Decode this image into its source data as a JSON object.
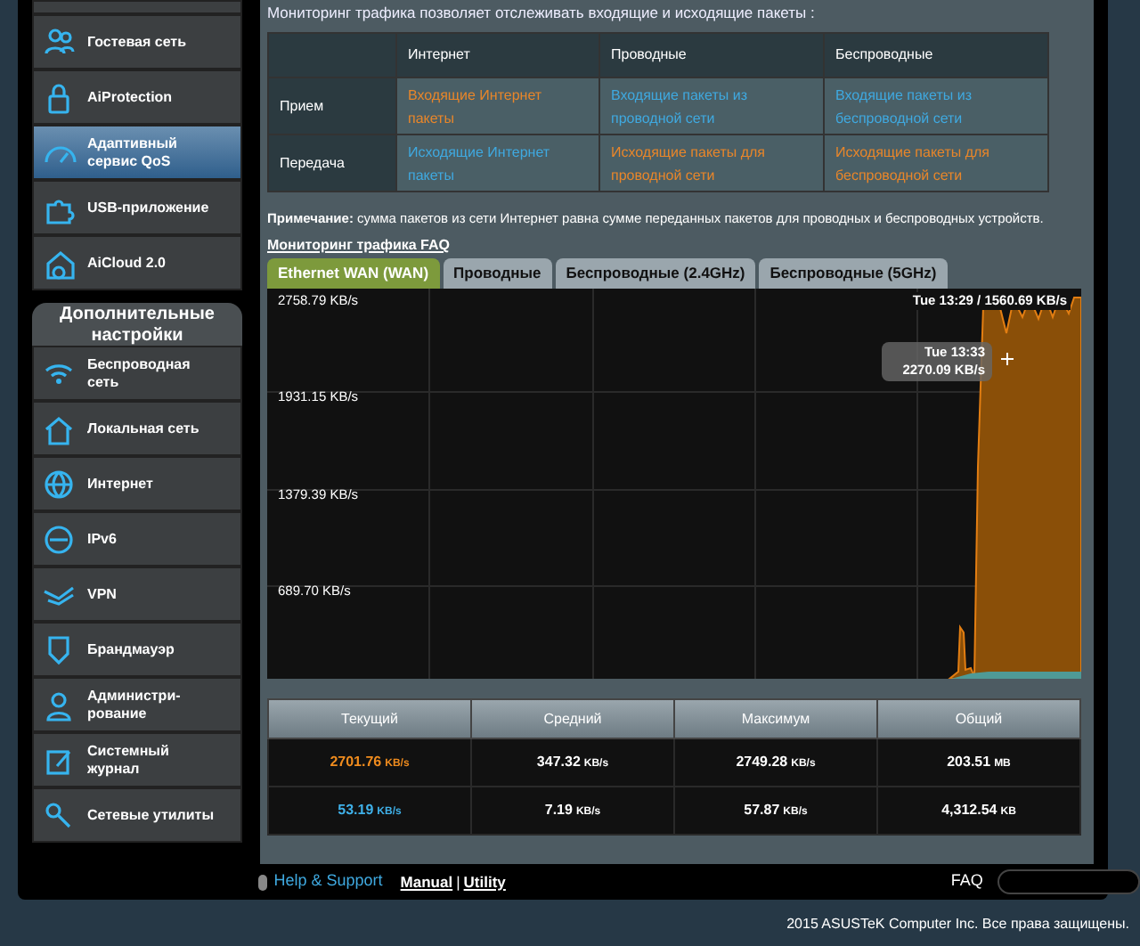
{
  "sidebar": {
    "items": [
      {
        "label": "Гостевая сеть",
        "selected": false
      },
      {
        "label": "AiProtection",
        "selected": false
      },
      {
        "label": "Адаптивный сервис QoS",
        "selected": true
      },
      {
        "label": "USB-приложение",
        "selected": false
      },
      {
        "label": "AiCloud 2.0",
        "selected": false
      }
    ],
    "advanced_header": "Дополнительные настройки",
    "advanced_items": [
      {
        "label": "Беспроводная сеть",
        "selected": false
      },
      {
        "label": "Локальная сеть",
        "selected": false
      },
      {
        "label": "Интернет",
        "selected": false
      },
      {
        "label": "IPv6",
        "selected": false
      },
      {
        "label": "VPN",
        "selected": false
      },
      {
        "label": "Брандмауэр",
        "selected": false
      },
      {
        "label": "Администри-рование",
        "selected": false
      },
      {
        "label": "Системный журнал",
        "selected": false
      },
      {
        "label": "Сетевые утилиты",
        "selected": false
      }
    ]
  },
  "intro": "Мониторинг трафика позволяет отслеживать входящие и исходящие пакеты :",
  "traffic_table": {
    "columns": [
      "Интернет",
      "Проводные",
      "Беспроводные"
    ],
    "rows": [
      {
        "label": "Прием",
        "cells": [
          {
            "text": "Входящие Интернет пакеты",
            "color": "#e8862a"
          },
          {
            "text": "Входящие пакеты из проводной сети",
            "color": "#3fa9e0"
          },
          {
            "text": "Входящие пакеты из беспроводной сети",
            "color": "#3fa9e0"
          }
        ]
      },
      {
        "label": "Передача",
        "cells": [
          {
            "text": "Исходящие Интернет пакеты",
            "color": "#3fa9e0"
          },
          {
            "text": "Исходящие пакеты для проводной сети",
            "color": "#e8862a"
          },
          {
            "text": "Исходящие пакеты для беспроводной сети",
            "color": "#e8862a"
          }
        ]
      }
    ]
  },
  "note": "**Примечание:** сумма пакетов из сети Интернет равна сумме переданных пакетов для проводных и беспроводных устройств.",
  "faq_link": "Мониторинг трафика FAQ",
  "tabs": [
    {
      "label": "Ethernet WAN (WAN)",
      "selected": true
    },
    {
      "label": "Проводные",
      "selected": false
    },
    {
      "label": "Беспроводные (2.4GHz)",
      "selected": false
    },
    {
      "label": "Беспроводные (5GHz)",
      "selected": false
    }
  ],
  "graph": {
    "y_labels": [
      "2758.79 KB/s",
      "1931.15 KB/s",
      "1379.39 KB/s",
      "689.70 KB/s"
    ],
    "header": "Tue 13:29 / 1560.69 KB/s",
    "tooltip": {
      "time": "Tue 13:33",
      "value": "2270.09 KB/s"
    }
  },
  "stats": {
    "columns": [
      "Текущий",
      "Средний",
      "Максимум",
      "Общий"
    ],
    "rows": [
      {
        "color": "#f08c1e",
        "cells": [
          {
            "value": "2701.76",
            "unit": "KB/s"
          },
          {
            "value": "347.32",
            "unit": "KB/s"
          },
          {
            "value": "2749.28",
            "unit": "KB/s"
          },
          {
            "value": "203.51",
            "unit": "MB"
          }
        ]
      },
      {
        "color": "#3fb0e8",
        "cells": [
          {
            "value": "53.19",
            "unit": "KB/s"
          },
          {
            "value": "7.19",
            "unit": "KB/s"
          },
          {
            "value": "57.87",
            "unit": "KB/s"
          },
          {
            "value": "4,312.54",
            "unit": "KB"
          }
        ]
      }
    ]
  },
  "footer": {
    "help": "Help & Support",
    "manual": "Manual",
    "separator": "|",
    "utility": "Utility",
    "faq_label": "FAQ"
  },
  "copyright": "2015 ASUSTeK Computer Inc. Все права защищены."
}
